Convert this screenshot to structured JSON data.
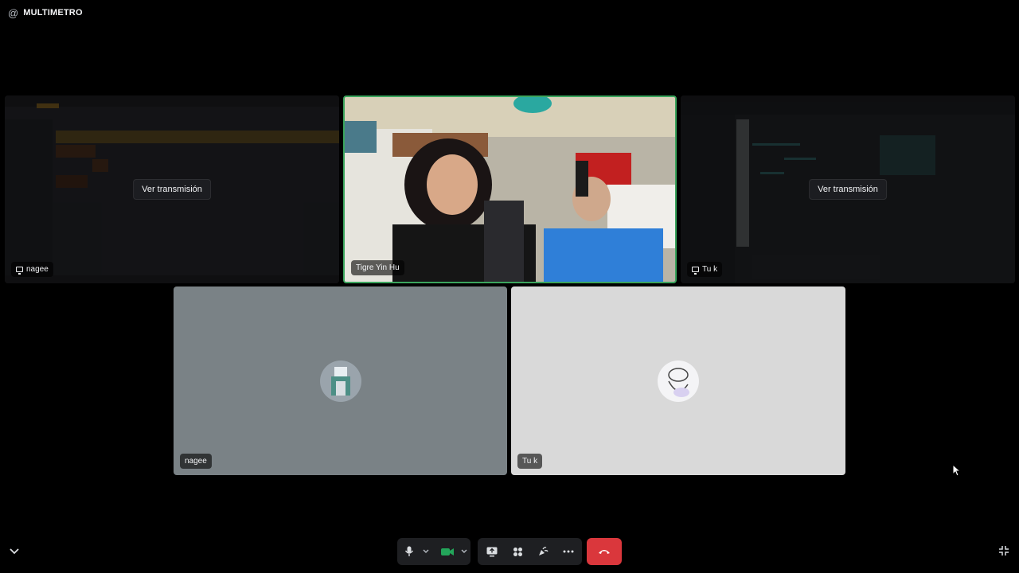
{
  "app": {
    "channel_icon": "@",
    "channel_name": "MULTIMETRO"
  },
  "tiles": [
    {
      "kind": "stream",
      "user": "nagee",
      "watch_label": "Ver transmisión"
    },
    {
      "kind": "camera",
      "user": "Tigre Yin Hu"
    },
    {
      "kind": "stream",
      "user": "Tu k",
      "watch_label": "Ver transmisión"
    },
    {
      "kind": "avatar",
      "user": "nagee"
    },
    {
      "kind": "avatar",
      "user": "Tu k"
    }
  ],
  "controls": {
    "icons": [
      "microphone-icon",
      "camera-icon",
      "screen-share-icon",
      "activities-icon",
      "soundboard-icon",
      "more-icon",
      "hangup-icon"
    ]
  },
  "colors": {
    "speaking_border": "#3ba55d",
    "hangup": "#da373c",
    "camera_on": "#23a55a",
    "tile_gray": "#7a8286",
    "tile_light": "#d9d9d9"
  }
}
